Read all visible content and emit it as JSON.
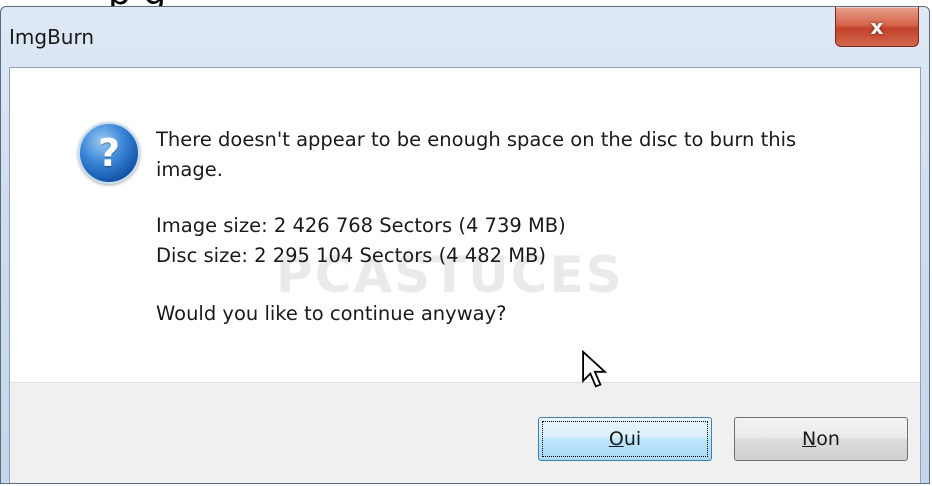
{
  "top_fragment": "p        g",
  "window": {
    "title": "ImgBurn",
    "close_glyph": "x"
  },
  "message": {
    "line1": "There doesn't appear to be enough space on the disc to burn this",
    "line2": "image.",
    "image_size": "Image size: 2 426 768 Sectors (4 739 MB)",
    "disc_size": "Disc size: 2 295 104 Sectors (4 482 MB)",
    "question": "Would you like to continue anyway?"
  },
  "watermark": "PCASTUCES",
  "buttons": {
    "yes": {
      "accel": "O",
      "rest": "ui"
    },
    "no": {
      "accel": "N",
      "rest": "on"
    }
  },
  "icons": {
    "dialog_icon": "question-icon",
    "close": "close-icon",
    "pointer": "mouse-pointer-icon"
  },
  "colors": {
    "close_button": "#c2412a",
    "default_button_border": "#3c7fb1",
    "question_icon": "#1453a8"
  }
}
